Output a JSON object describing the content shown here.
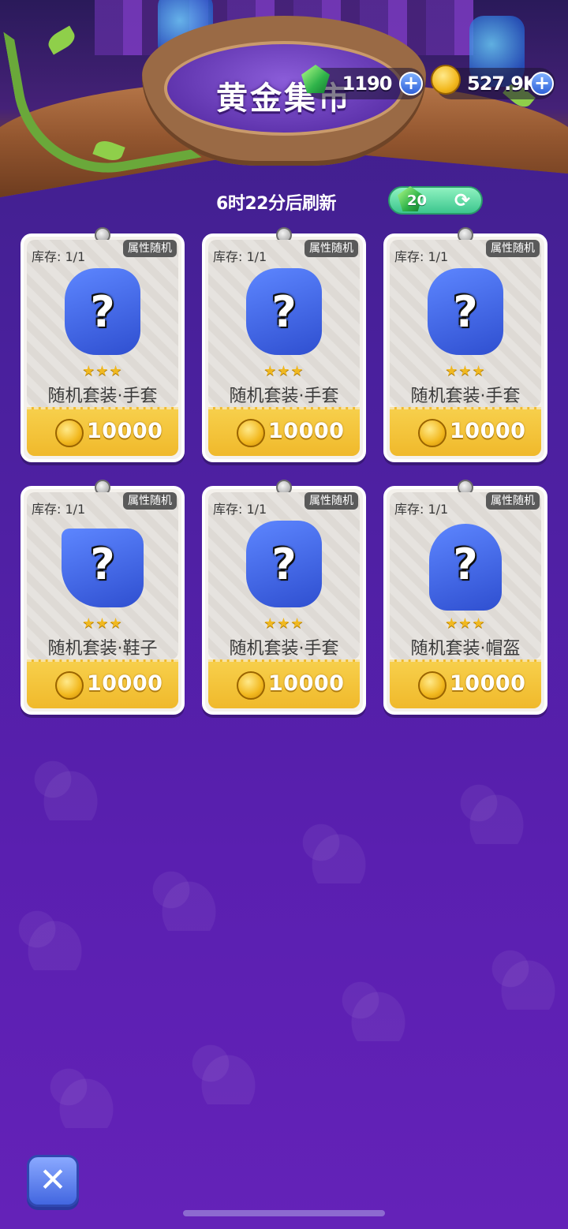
{
  "title": "黄金集市",
  "currencies": {
    "gems": {
      "value": "1190",
      "icon": "gem-icon"
    },
    "coins": {
      "value": "527.9K",
      "icon": "coin-icon"
    }
  },
  "refresh": {
    "countdown_text": "6时22分后刷新",
    "cost": "20",
    "icon": "refresh-icon"
  },
  "cards": [
    {
      "stock": "库存: 1/1",
      "tag": "属性随机",
      "stars": "★★★",
      "name": "随机套装·手套",
      "price": "10000",
      "item": "glove"
    },
    {
      "stock": "库存: 1/1",
      "tag": "属性随机",
      "stars": "★★★",
      "name": "随机套装·手套",
      "price": "10000",
      "item": "glove"
    },
    {
      "stock": "库存: 1/1",
      "tag": "属性随机",
      "stars": "★★★",
      "name": "随机套装·手套",
      "price": "10000",
      "item": "glove"
    },
    {
      "stock": "库存: 1/1",
      "tag": "属性随机",
      "stars": "★★★",
      "name": "随机套装·鞋子",
      "price": "10000",
      "item": "boot"
    },
    {
      "stock": "库存: 1/1",
      "tag": "属性随机",
      "stars": "★★★",
      "name": "随机套装·手套",
      "price": "10000",
      "item": "glove"
    },
    {
      "stock": "库存: 1/1",
      "tag": "属性随机",
      "stars": "★★★",
      "name": "随机套装·帽盔",
      "price": "10000",
      "item": "helmet"
    }
  ],
  "close_icon": "close-icon",
  "colors": {
    "background": "#4a209d",
    "accent": "#f0b92b",
    "refresh": "#3cc68e"
  }
}
